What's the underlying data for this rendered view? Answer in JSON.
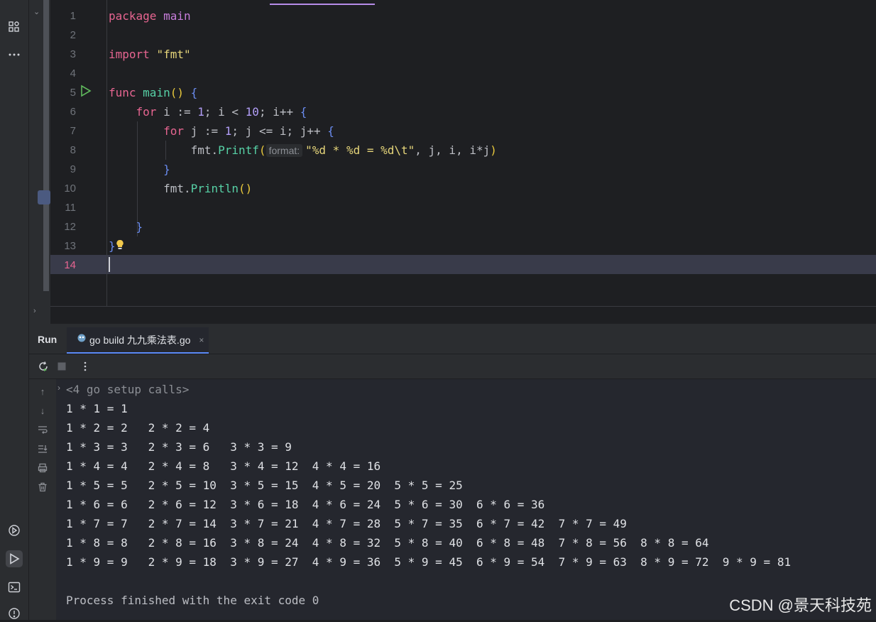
{
  "editor": {
    "line_numbers": [
      "1",
      "2",
      "3",
      "4",
      "5",
      "6",
      "7",
      "8",
      "9",
      "10",
      "11",
      "12",
      "13",
      "14"
    ],
    "current_line": "14",
    "code": {
      "l1_kw": "package",
      "l1_name": " main",
      "l3_kw": "import ",
      "l3_str": "\"fmt\"",
      "l5_kw": "func ",
      "l5_fn": "main",
      "l5_paren": "()",
      "l5_brace": " {",
      "l6_kw": "for",
      "l6_a": " i := ",
      "l6_n1": "1",
      "l6_b": "; i < ",
      "l6_n2": "10",
      "l6_c": "; i++ ",
      "l6_brace": "{",
      "l7_kw": "for",
      "l7_a": " j := ",
      "l7_n1": "1",
      "l7_b": "; j <= i; j++ ",
      "l7_brace": "{",
      "l8_pkg": "fmt.",
      "l8_fn": "Printf",
      "l8_open": "(",
      "l8_hint": "format:",
      "l8_str": "\"%d * %d = %d\\t\"",
      "l8_args": ", j, i, i*j",
      "l8_close": ")",
      "l9_brace": "}",
      "l10_pkg": "fmt.",
      "l10_fn": "Println",
      "l10_paren": "()",
      "l12_brace": "}",
      "l13_brace": "}"
    }
  },
  "run_panel": {
    "title": "Run",
    "tab_label": "go build 九九乘法表.go",
    "tab_close": "×",
    "setup_calls": "<4 go setup calls>",
    "output_lines": [
      "1 * 1 = 1",
      "1 * 2 = 2   2 * 2 = 4",
      "1 * 3 = 3   2 * 3 = 6   3 * 3 = 9",
      "1 * 4 = 4   2 * 4 = 8   3 * 4 = 12  4 * 4 = 16",
      "1 * 5 = 5   2 * 5 = 10  3 * 5 = 15  4 * 5 = 20  5 * 5 = 25",
      "1 * 6 = 6   2 * 6 = 12  3 * 6 = 18  4 * 6 = 24  5 * 6 = 30  6 * 6 = 36",
      "1 * 7 = 7   2 * 7 = 14  3 * 7 = 21  4 * 7 = 28  5 * 7 = 35  6 * 7 = 42  7 * 7 = 49",
      "1 * 8 = 8   2 * 8 = 16  3 * 8 = 24  4 * 8 = 32  5 * 8 = 40  6 * 8 = 48  7 * 8 = 56  8 * 8 = 64",
      "1 * 9 = 9   2 * 9 = 18  3 * 9 = 27  4 * 9 = 36  5 * 9 = 45  6 * 9 = 54  7 * 9 = 63  8 * 9 = 72  9 * 9 = 81"
    ],
    "exit_message": "Process finished with the exit code 0"
  },
  "watermark": "CSDN @景天科技苑",
  "colors": {
    "keyword": "#e76591",
    "function": "#57d1a6",
    "string": "#e6d57a",
    "number": "#b29ef7",
    "accent": "#5b8af7"
  }
}
